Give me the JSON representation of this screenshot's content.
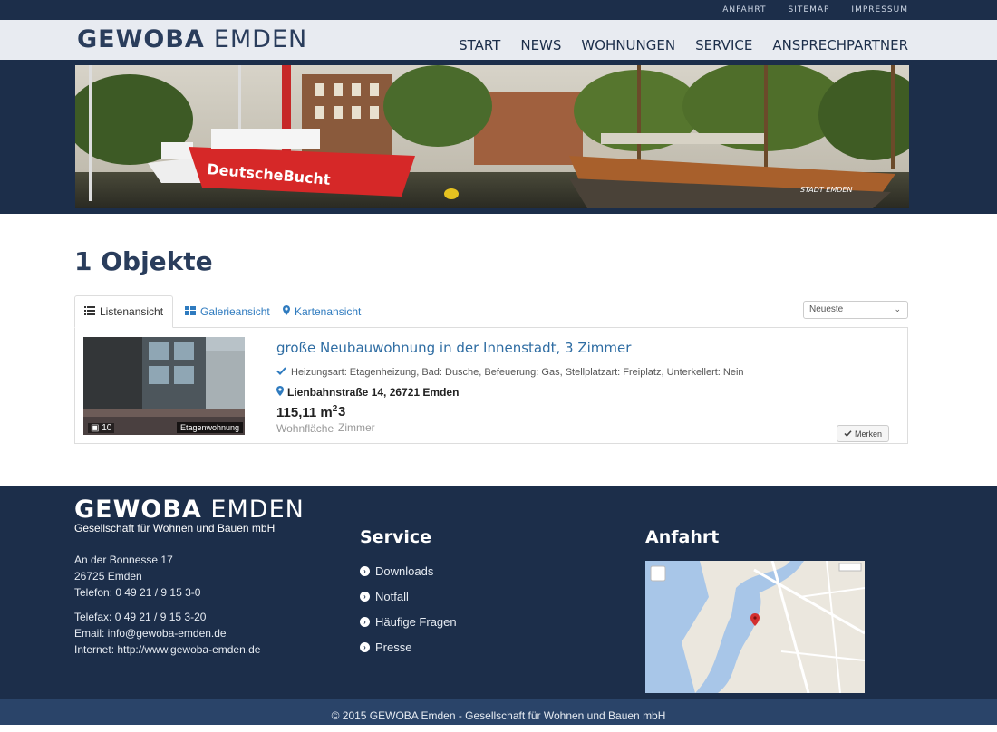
{
  "topbar": {
    "links": [
      "ANFAHRT",
      "SITEMAP",
      "IMPRESSUM"
    ]
  },
  "header": {
    "logo_part1": "GEWOBA",
    "logo_part2": "EMDEN",
    "nav": [
      "START",
      "NEWS",
      "WOHNUNGEN",
      "SERVICE",
      "ANSPRECHPARTNER"
    ]
  },
  "banner": {
    "ship_name": "DeutscheBucht",
    "boat_name": "STADT EMDEN"
  },
  "main": {
    "title": "1 Objekte",
    "tabs": [
      "Listenansicht",
      "Galerieansicht",
      "Kartenansicht"
    ],
    "sort_value": "Neueste",
    "listing": {
      "title": "große Neubauwohnung in der Innenstadt, 3 Zimmer",
      "features": "Heizungsart: Etagenheizung, Bad: Dusche, Befeuerung: Gas, Stellplatzart: Freiplatz, Unterkellert: Nein",
      "address": "Lienbahnstraße 14, 26721 Emden",
      "area_value": "115,11 m",
      "area_sup": "2",
      "area_label": "Wohnfläche",
      "rooms_value": "3",
      "rooms_label": "Zimmer",
      "photo_count": "10",
      "type_badge": "Etagenwohnung",
      "merken": "Merken"
    }
  },
  "footer": {
    "logo_part1": "GEWOBA",
    "logo_part2": "EMDEN",
    "subtitle": "Gesellschaft für Wohnen und Bauen mbH",
    "address_lines": [
      "An der Bonnesse 17",
      "26725 Emden",
      "Telefon: 0 49 21 / 9 15 3-0"
    ],
    "contact_lines": [
      "Telefax: 0 49 21 / 9 15 3-20",
      "Email: info@gewoba-emden.de",
      "Internet: http://www.gewoba-emden.de"
    ],
    "service_title": "Service",
    "service_links": [
      "Downloads",
      "Notfall",
      "Häufige Fragen",
      "Presse"
    ],
    "anfahrt_title": "Anfahrt",
    "copyright": "© 2015 GEWOBA Emden - Gesellschaft für Wohnen und Bauen mbH"
  },
  "colors": {
    "navy": "#1c2e4a",
    "link_blue": "#2f7bbf",
    "header_bg": "#e8ebf1"
  }
}
